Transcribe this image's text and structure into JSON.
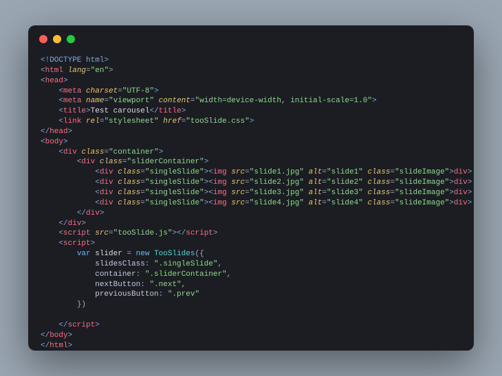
{
  "traffic_lights": {
    "close": "#ff5f56",
    "min": "#ffbd2e",
    "max": "#27c93f"
  },
  "code": {
    "l1": {
      "doctype": "<!DOCTYPE html>"
    },
    "l2": {
      "open": "<",
      "tag": "html",
      "attr": "lang",
      "eq": "=",
      "val": "\"en\"",
      "close": ">"
    },
    "l3": {
      "open": "<",
      "tag": "head",
      "close": ">"
    },
    "l4": {
      "ind": "    ",
      "open": "<",
      "tag": "meta",
      "attr": "charset",
      "eq": "=",
      "val": "\"UTF-8\"",
      "close": ">"
    },
    "l5": {
      "ind": "    ",
      "open": "<",
      "tag": "meta",
      "attr1": "name",
      "eq1": "=",
      "val1": "\"viewport\"",
      "sp1": " ",
      "attr2": "content",
      "eq2": "=",
      "val2": "\"width=device-width, initial-scale=1.0\"",
      "close": ">"
    },
    "l6": {
      "ind": "    ",
      "open": "<",
      "tag": "title",
      "close": ">",
      "text": "Test carousel",
      "open2": "</",
      "tag2": "title",
      "close2": ">"
    },
    "l7": {
      "ind": "    ",
      "open": "<",
      "tag": "link",
      "attr1": "rel",
      "eq1": "=",
      "val1": "\"stylesheet\"",
      "sp1": " ",
      "attr2": "href",
      "eq2": "=",
      "val2": "\"tooSlide.css\"",
      "close": ">"
    },
    "l8": {
      "open": "</",
      "tag": "head",
      "close": ">"
    },
    "l9": {
      "open": "<",
      "tag": "body",
      "close": ">"
    },
    "l10": {
      "ind": "    ",
      "open": "<",
      "tag": "div",
      "attr": "class",
      "eq": "=",
      "val": "\"container\"",
      "close": ">"
    },
    "l11": {
      "ind": "        ",
      "open": "<",
      "tag": "div",
      "attr": "class",
      "eq": "=",
      "val": "\"sliderContainer\"",
      "close": ">"
    },
    "slides": [
      {
        "i": 1,
        "ind": "            ",
        "d1o": "<",
        "d1t": "div",
        "d1a": "class",
        "d1e": "=",
        "d1v": "\"singleSlide\"",
        "d1c": ">",
        "io": "<",
        "it": "img",
        "ia1": "src",
        "ie1": "=",
        "iv1": "\"slide1.jpg\"",
        "isp1": " ",
        "ia2": "alt",
        "ie2": "=",
        "iv2": "\"slide1\"",
        "isp2": " ",
        "ia3": "class",
        "ie3": "=",
        "iv3": "\"slideImage\"",
        "ic": ">",
        "d2o": "</",
        "d2t": "div",
        "d2c": ">"
      },
      {
        "i": 2,
        "ind": "            ",
        "d1o": "<",
        "d1t": "div",
        "d1a": "class",
        "d1e": "=",
        "d1v": "\"singleSlide\"",
        "d1c": ">",
        "io": "<",
        "it": "img",
        "ia1": "src",
        "ie1": "=",
        "iv1": "\"slide2.jpg\"",
        "isp1": " ",
        "ia2": "alt",
        "ie2": "=",
        "iv2": "\"slide2\"",
        "isp2": " ",
        "ia3": "class",
        "ie3": "=",
        "iv3": "\"slideImage\"",
        "ic": ">",
        "d2o": "</",
        "d2t": "div",
        "d2c": ">"
      },
      {
        "i": 3,
        "ind": "            ",
        "d1o": "<",
        "d1t": "div",
        "d1a": "class",
        "d1e": "=",
        "d1v": "\"singleSlide\"",
        "d1c": ">",
        "io": "<",
        "it": "img",
        "ia1": "src",
        "ie1": "=",
        "iv1": "\"slide3.jpg\"",
        "isp1": " ",
        "ia2": "alt",
        "ie2": "=",
        "iv2": "\"slide3\"",
        "isp2": " ",
        "ia3": "class",
        "ie3": "=",
        "iv3": "\"slideImage\"",
        "ic": ">",
        "d2o": "</",
        "d2t": "div",
        "d2c": ">"
      },
      {
        "i": 4,
        "ind": "            ",
        "d1o": "<",
        "d1t": "div",
        "d1a": "class",
        "d1e": "=",
        "d1v": "\"singleSlide\"",
        "d1c": ">",
        "io": "<",
        "it": "img",
        "ia1": "src",
        "ie1": "=",
        "iv1": "\"slide4.jpg\"",
        "isp1": " ",
        "ia2": "alt",
        "ie2": "=",
        "iv2": "\"slide4\"",
        "isp2": " ",
        "ia3": "class",
        "ie3": "=",
        "iv3": "\"slideImage\"",
        "ic": ">",
        "d2o": "</",
        "d2t": "div",
        "d2c": ">"
      }
    ],
    "l16": {
      "ind": "        ",
      "open": "</",
      "tag": "div",
      "close": ">"
    },
    "l17": {
      "ind": "    ",
      "open": "</",
      "tag": "div",
      "close": ">"
    },
    "l18": {
      "ind": "    ",
      "open": "<",
      "tag": "script",
      "attr": "src",
      "eq": "=",
      "val": "\"tooSlide.js\"",
      "close": ">",
      "open2": "</",
      "tag2": "script",
      "close2": ">"
    },
    "l19": {
      "ind": "    ",
      "open": "<",
      "tag": "script",
      "close": ">"
    },
    "l20": {
      "ind": "        ",
      "kw1": "var",
      "sp1": " ",
      "id": "slider",
      "sp2": " = ",
      "kw2": "new",
      "sp3": " ",
      "cls": "TooSlides",
      "paren": "({"
    },
    "l21": {
      "ind": "            ",
      "prop": "slidesClass",
      "colon": ": ",
      "val": "\".singleSlide\"",
      "comma": ","
    },
    "l22": {
      "ind": "            ",
      "prop": "container",
      "colon": ": ",
      "val": "\".sliderContainer\"",
      "comma": ","
    },
    "l23": {
      "ind": "            ",
      "prop": "nextButton",
      "colon": ": ",
      "val": "\".next\"",
      "comma": ","
    },
    "l24": {
      "ind": "            ",
      "prop": "previousButton",
      "colon": ": ",
      "val": "\".prev\"",
      "comma": ""
    },
    "l25": {
      "ind": "        ",
      "text": "})"
    },
    "l26": {
      "text": ""
    },
    "l27": {
      "ind": "    ",
      "open": "</",
      "tag": "script",
      "close": ">"
    },
    "l28": {
      "open": "</",
      "tag": "body",
      "close": ">"
    },
    "l29": {
      "open": "</",
      "tag": "html",
      "close": ">"
    }
  }
}
